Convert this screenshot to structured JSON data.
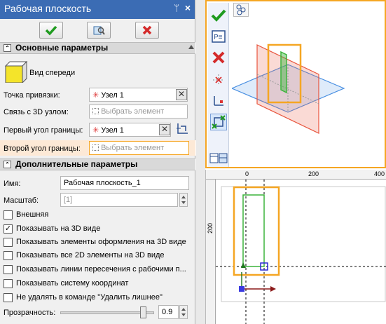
{
  "panel": {
    "title": "Рабочая плоскость",
    "title_buttons": {
      "pin": "ᛘ",
      "close": "×"
    },
    "section1": "Основные параметры",
    "view_label": "Вид спереди",
    "anchor_label": "Точка привязки:",
    "anchor_value": "Узел 1",
    "link3d_label": "Связь с 3D узлом:",
    "link3d_placeholder": "Выбрать элемент",
    "first_corner_label": "Первый угол границы:",
    "first_corner_value": "Узел 1",
    "second_corner_label": "Второй угол границы:",
    "second_corner_placeholder": "Выбрать элемент",
    "section2": "Дополнительные параметры",
    "name_label": "Имя:",
    "name_value": "Рабочая плоскость_1",
    "scale_label": "Масштаб:",
    "scale_value": "[1]",
    "checkboxes": [
      {
        "label": "Внешняя",
        "checked": false
      },
      {
        "label": "Показывать на 3D виде",
        "checked": true
      },
      {
        "label": "Показывать элементы оформления на 3D виде",
        "checked": false
      },
      {
        "label": "Показывать все 2D элементы на 3D виде",
        "checked": false
      },
      {
        "label": "Показывать линии пересечения с рабочими п...",
        "checked": false
      },
      {
        "label": "Показывать систему координат",
        "checked": false
      },
      {
        "label": "Не удалять в команде \"Удалить лишнее\"",
        "checked": false
      }
    ],
    "transparency_label": "Прозрачность:",
    "transparency_value": "0.9",
    "transparency_level": 0.9
  },
  "view2d": {
    "ruler_labels": [
      "0",
      "200",
      "400"
    ],
    "vruler_labels": [
      "200"
    ]
  },
  "colors": {
    "accent": "#f5a623",
    "title_bg": "#3b6cb4",
    "plane_red": "#e8553e",
    "plane_blue": "#4a90e2",
    "green": "#3cb43c"
  }
}
